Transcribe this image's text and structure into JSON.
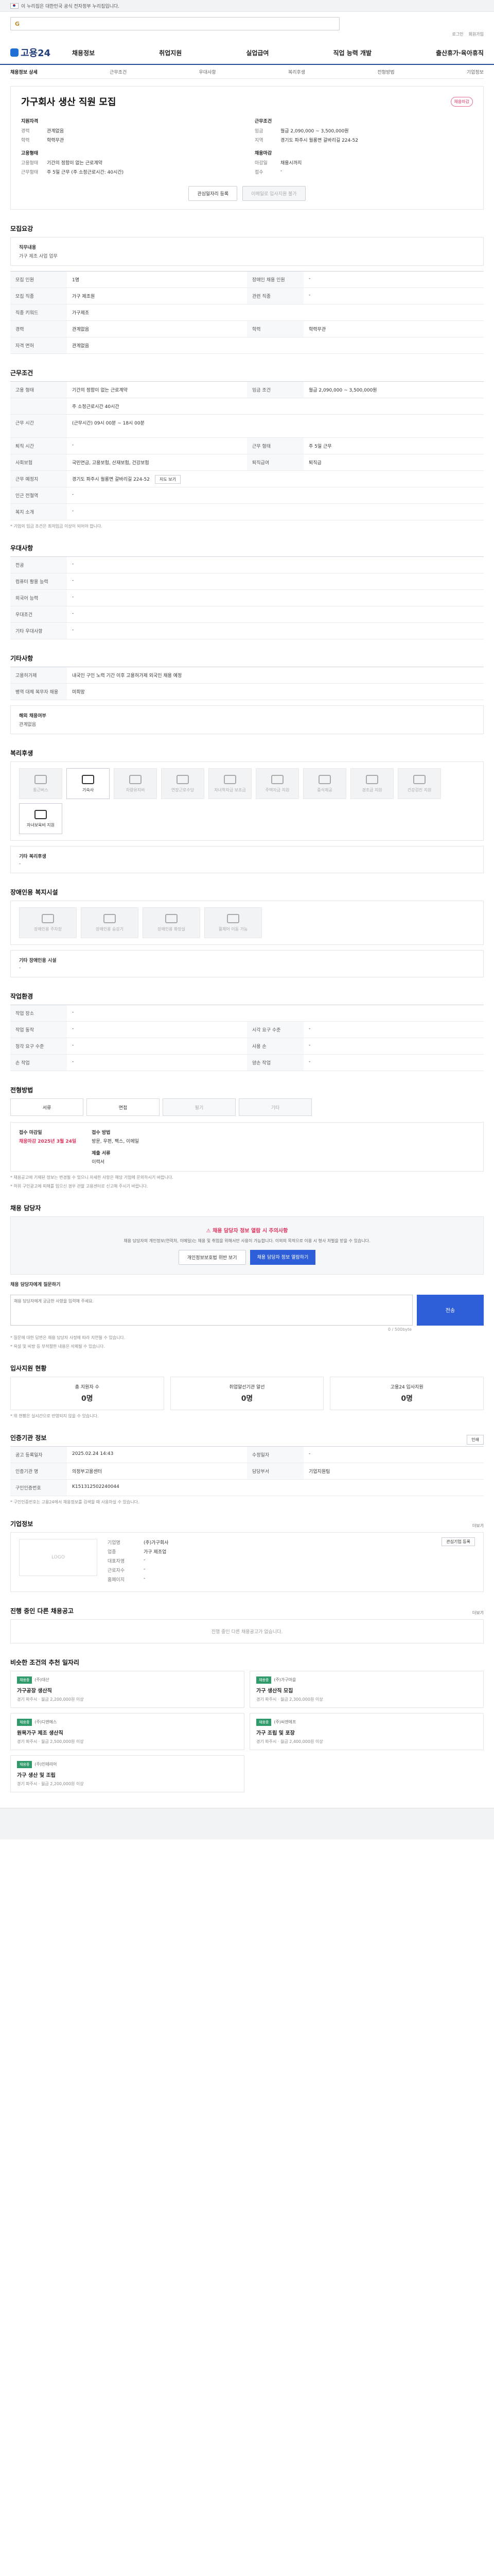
{
  "topbar": {
    "notice": "이 누리집은 대한민국 공식 전자정부 누리집입니다."
  },
  "search": {
    "logo_mark": "G",
    "placeholder": "검색어를 입력하세요"
  },
  "util": [
    "로그인",
    "회원가입"
  ],
  "logo": "고용24",
  "gnb": [
    "채용정보",
    "취업지원",
    "실업급여",
    "직업 능력 개발",
    "출산휴가·육아휴직"
  ],
  "subnav": [
    "채용정보 상세",
    "근무조건",
    "우대사항",
    "복리후생",
    "전형방법",
    "기업정보"
  ],
  "title": {
    "heading": "가구회사 생산 직원 모집",
    "badge": "채용마감"
  },
  "summary": {
    "left_head": "지원자격",
    "left_rows": [
      {
        "k": "경력",
        "v": "관계없음"
      },
      {
        "k": "학력",
        "v": "학력무관"
      }
    ],
    "left_head2": "고용형태",
    "left_rows2": [
      {
        "k": "고용형태",
        "v": "기간의 정함이 없는 근로계약"
      },
      {
        "k": "근무형태",
        "v": "주 5일 근무 (주 소정근로시간: 40시간)"
      }
    ],
    "right_head": "근무조건",
    "right_rows": [
      {
        "k": "임금",
        "v": "월급 2,090,000 ~ 3,500,000원"
      },
      {
        "k": "지역",
        "v": "경기도 파주시 월롱면 갈바리길 224-52"
      }
    ],
    "right_head2": "채용마감",
    "right_rows2": [
      {
        "k": "마감일",
        "v": "채용시까지"
      },
      {
        "k": "접수",
        "v": "-"
      }
    ]
  },
  "buttons": {
    "scrap": "관심일자리 등록",
    "apply": "이메일로 입사지원 불가"
  },
  "recruit": {
    "title": "모집요강",
    "job_title": "직무내용",
    "job_desc": "가구 제조 사업 업무",
    "rows": [
      [
        {
          "k": "모집 인원",
          "v": "1명"
        },
        {
          "k": "장애인 채용 인원",
          "v": "-"
        }
      ],
      [
        {
          "k": "모집 직종",
          "v": "가구 제조원"
        },
        {
          "k": "관련 직종",
          "v": "-"
        }
      ],
      [
        {
          "k": "직종 키워드",
          "v": "가구제조"
        },
        {
          "k": "",
          "v": ""
        }
      ],
      [
        {
          "k": "경력",
          "v": "관계없음"
        },
        {
          "k": "학력",
          "v": "학력무관"
        }
      ],
      [
        {
          "k": "자격 면허",
          "v": "관계없음"
        },
        {
          "k": "",
          "v": ""
        }
      ]
    ]
  },
  "conditions": {
    "title": "근무조건",
    "rows": [
      [
        {
          "k": "고용 형태",
          "v": "기간의 정함이 없는 근로계약"
        },
        {
          "k": "임금 조건",
          "v": "월급 2,090,000 ~ 3,500,000원"
        }
      ],
      [
        {
          "k": "",
          "v": "주 소정근로시간 40시간"
        },
        {
          "k": "",
          "v": ""
        }
      ],
      [
        {
          "k": "근무 시간",
          "v": "(근무시간) 09시 00분 ~ 18시 00분"
        },
        {
          "k": "",
          "v": ""
        }
      ],
      [
        {
          "k": "퇴직 시간",
          "v": "-"
        },
        {
          "k": "근무 형태",
          "v": "주 5일 근무"
        }
      ],
      [
        {
          "k": "사회보험",
          "v": "국민연금, 고용보험, 산재보험, 건강보험"
        },
        {
          "k": "퇴직급여",
          "v": "퇴직금"
        }
      ],
      [
        {
          "k": "근무 예정지",
          "v": "경기도 파주시 월롱면 갈바리길 224-52"
        },
        {
          "k": "",
          "v": ""
        }
      ],
      [
        {
          "k": "인근 전철역",
          "v": "-"
        },
        {
          "k": "",
          "v": ""
        }
      ],
      [
        {
          "k": "복지 소개",
          "v": "-"
        },
        {
          "k": "",
          "v": ""
        }
      ]
    ],
    "map_button": "지도 보기",
    "note": "* 기업의 임금 조건은 최저임금 이상이 되어야 합니다."
  },
  "preference": {
    "title": "우대사항",
    "rows": [
      {
        "k": "전공",
        "v": "-"
      },
      {
        "k": "컴퓨터 활용 능력",
        "v": "-"
      },
      {
        "k": "외국어 능력",
        "v": "-"
      },
      {
        "k": "우대조건",
        "v": "-"
      },
      {
        "k": "기타 우대사항",
        "v": "-"
      }
    ]
  },
  "other": {
    "title": "기타사항",
    "rows": [
      {
        "k": "고용허가제",
        "v": "내국인 구인 노력 기간 이후 고용허가제 외국인 채용 예정"
      },
      {
        "k": "병역 대체 복무자 채용",
        "v": "미희망"
      }
    ],
    "sub_title": "해외 채용여부",
    "sub_value": "관계없음"
  },
  "welfare": {
    "title": "복리후생",
    "items": [
      {
        "label": "통근버스",
        "on": false
      },
      {
        "label": "기숙사",
        "on": true
      },
      {
        "label": "차량유지비",
        "on": false
      },
      {
        "label": "연장근로수당",
        "on": false
      },
      {
        "label": "자녀학자금 보조금",
        "on": false
      },
      {
        "label": "주택자금 지원",
        "on": false
      },
      {
        "label": "중식제공",
        "on": false
      },
      {
        "label": "경조금 지원",
        "on": false
      },
      {
        "label": "건강검진 지원",
        "on": false
      },
      {
        "label": "자녀보육비 지원",
        "on": true
      }
    ],
    "etc_title": "기타 복리후생",
    "etc_value": "-"
  },
  "disability": {
    "title": "장애인용 복지시설",
    "items": [
      "장애인용 주차장",
      "장애인용 승강기",
      "장애인용 화장실",
      "휠체어 이동 가능"
    ],
    "etc_title": "기타 장애인용 시설",
    "etc_value": "-"
  },
  "workenv": {
    "title": "작업환경",
    "rows": [
      [
        {
          "k": "작업 장소",
          "v": "-"
        },
        {
          "k": "",
          "v": ""
        }
      ],
      [
        {
          "k": "작업 동작",
          "v": "-"
        },
        {
          "k": "시각 요구 수준",
          "v": "-"
        }
      ],
      [
        {
          "k": "청각 요구 수준",
          "v": "-"
        },
        {
          "k": "사용 손",
          "v": "-"
        }
      ],
      [
        {
          "k": "손 작업",
          "v": "-"
        },
        {
          "k": "양손 작업",
          "v": "-"
        }
      ]
    ]
  },
  "screening": {
    "title": "전형방법",
    "steps": [
      {
        "label": "서류",
        "on": true
      },
      {
        "label": "면접",
        "on": true
      },
      {
        "label": "필기",
        "on": false
      },
      {
        "label": "기타",
        "on": false
      }
    ],
    "apply_title": "접수 마감일",
    "apply_deadline": "채용마감 2025년 3월 24일",
    "method_title": "접수 방법",
    "method_value": "방문, 우편, 팩스, 이메일",
    "docs_title": "제출 서류",
    "docs_value": "이력서",
    "notes": [
      "* 채용공고에 기재된 정보는 변경될 수 있으니 자세한 사항은 해당 기업에 문의하시기 바랍니다.",
      "* 허위 구인광고에 피해를 입으신 경우 관할 고용센터로 신고해 주시기 바랍니다."
    ]
  },
  "contact": {
    "title": "채용 담당자",
    "warn_head": "채용 담당자 정보 열람 시 주의사항",
    "warn_body": "채용 담당자의 개인정보(연락처, 이메일)는 채용 및 취업을 위해서만 사용이 가능합니다. 이외의 목적으로 이용 시 형사 처벌을 받을 수 있습니다.",
    "btn_check": "개인정보보호법 위반 보기",
    "btn_view": "채용 담당자 정보 열람하기",
    "inquiry_label": "채용 담당자에게 질문하기",
    "inquiry_placeholder": "채용 담당자에게 궁금한 사항을 입력해 주세요.",
    "inquiry_send": "전송",
    "counter": "0 / 500byte",
    "notes": [
      "* 질문에 대한 답변은 채용 담당자 사정에 따라 지연될 수 있습니다.",
      "* 욕설 및 비방 등 부적절한 내용은 삭제될 수 있습니다."
    ]
  },
  "stats": {
    "title": "입사지원 현황",
    "items": [
      {
        "label": "총 지원자 수",
        "value": "0명"
      },
      {
        "label": "취업알선기관 알선",
        "value": "0명"
      },
      {
        "label": "고용24 입사지원",
        "value": "0명"
      }
    ],
    "note": "* 위 현황은 실시간으로 반영되지 않을 수 있습니다."
  },
  "agency": {
    "title": "인증기관 정보",
    "print": "인쇄",
    "rows": [
      [
        {
          "k": "공고 등록일자",
          "v": "2025.02.24 14:43"
        },
        {
          "k": "수정일자",
          "v": "-"
        }
      ],
      [
        {
          "k": "인증기관 명",
          "v": "의정부고용센터"
        },
        {
          "k": "담당부서",
          "v": "기업지원팀"
        }
      ],
      [
        {
          "k": "구인인증번호",
          "v": "K151312502240044"
        },
        {
          "k": "",
          "v": ""
        }
      ]
    ],
    "note": "* 구인인증번호는 고용24에서 채용정보를 검색할 때 사용하실 수 있습니다."
  },
  "company": {
    "title": "기업정보",
    "more": "더보기",
    "logo_placeholder": "LOGO",
    "rows": [
      {
        "k": "기업명",
        "v": "(주)가구회사"
      },
      {
        "k": "업종",
        "v": "가구 제조업"
      },
      {
        "k": "대표자명",
        "v": "-"
      },
      {
        "k": "근로자수",
        "v": "-"
      },
      {
        "k": "홈페이지",
        "v": "-"
      }
    ],
    "btn_like": "관심기업 등록"
  },
  "ongoing": {
    "title": "진행 중인 다른 채용공고",
    "more": "더보기",
    "empty": "진행 중인 다른 채용공고가 없습니다."
  },
  "recommend": {
    "title": "비슷한 조건의 추천 일자리",
    "cards": [
      {
        "tag": "채용중",
        "company": "(주)대산",
        "title": "가구공장 생산직",
        "meta": "경기 파주시 · 월급 2,200,000원 이상"
      },
      {
        "tag": "채용중",
        "company": "(주)가구마을",
        "title": "가구 생산직 모집",
        "meta": "경기 파주시 · 월급 2,300,000원 이상"
      },
      {
        "tag": "채용중",
        "company": "(주)디앤에스",
        "title": "원목가구 제조 생산직",
        "meta": "경기 파주시 · 월급 2,500,000원 이상"
      },
      {
        "tag": "채용중",
        "company": "(주)씨엔에프",
        "title": "가구 조립 및 포장",
        "meta": "경기 파주시 · 월급 2,400,000원 이상"
      },
      {
        "tag": "채용중",
        "company": "(주)인테리어",
        "title": "가구 생산 및 조립",
        "meta": "경기 파주시 · 월급 2,200,000원 이상"
      }
    ]
  }
}
